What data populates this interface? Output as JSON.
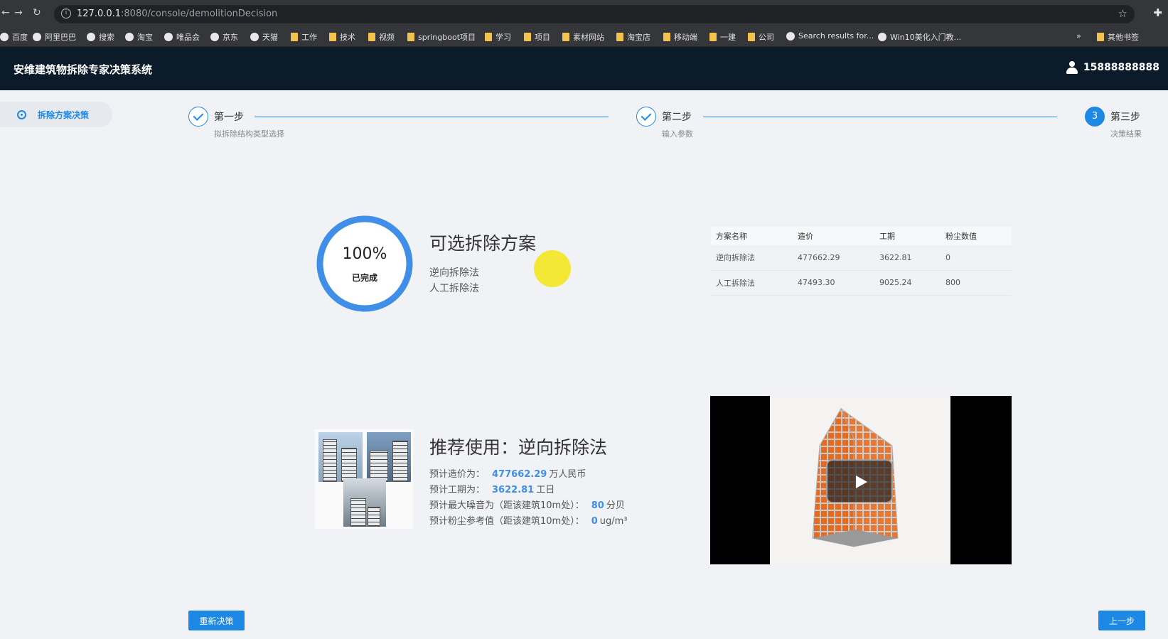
{
  "browser": {
    "url_host": "127.0.0.1",
    "url_rest": ":8080/console/demolitionDecision",
    "bookmarks": [
      {
        "label": "百度",
        "kind": "globe"
      },
      {
        "label": "阿里巴巴",
        "kind": "globe"
      },
      {
        "label": "搜索",
        "kind": "globe"
      },
      {
        "label": "淘宝",
        "kind": "globe"
      },
      {
        "label": "唯品会",
        "kind": "globe"
      },
      {
        "label": "京东",
        "kind": "globe"
      },
      {
        "label": "天猫",
        "kind": "globe"
      },
      {
        "label": "工作",
        "kind": "folder"
      },
      {
        "label": "技术",
        "kind": "folder"
      },
      {
        "label": "视频",
        "kind": "folder"
      },
      {
        "label": "springboot项目",
        "kind": "folder"
      },
      {
        "label": "学习",
        "kind": "folder"
      },
      {
        "label": "项目",
        "kind": "folder"
      },
      {
        "label": "素材网站",
        "kind": "folder"
      },
      {
        "label": "淘宝店",
        "kind": "folder"
      },
      {
        "label": "移动端",
        "kind": "folder"
      },
      {
        "label": "一建",
        "kind": "folder"
      },
      {
        "label": "公司",
        "kind": "folder"
      },
      {
        "label": "Search results for...",
        "kind": "globe"
      },
      {
        "label": "Win10美化入门教...",
        "kind": "globe"
      }
    ],
    "more": "»",
    "other_bookmarks": "其他书签"
  },
  "app": {
    "title": "安维建筑物拆除专家决策系统",
    "username": "15888888888"
  },
  "sidebar": {
    "items": [
      {
        "label": "拆除方案决策"
      }
    ]
  },
  "steps": [
    {
      "title": "第一步",
      "desc": "拟拆除结构类型选择",
      "status": "done"
    },
    {
      "title": "第二步",
      "desc": "输入参数",
      "status": "done"
    },
    {
      "title": "第三步",
      "desc": "决策结果",
      "status": "active",
      "number": "3"
    }
  ],
  "progress": {
    "percent_label": "100%",
    "status": "已完成",
    "fraction": 1.0
  },
  "options": {
    "title": "可选拆除方案",
    "items": [
      "逆向拆除法",
      "人工拆除法"
    ]
  },
  "table": {
    "headers": [
      "方案名称",
      "造价",
      "工期",
      "粉尘数值"
    ],
    "rows": [
      [
        "逆向拆除法",
        "477662.29",
        "3622.81",
        "0"
      ],
      [
        "人工拆除法",
        "47493.30",
        "9025.24",
        "800"
      ]
    ]
  },
  "recommendation": {
    "title": "推荐使用：逆向拆除法",
    "rows": [
      {
        "label": "预计造价为：",
        "value": "477662.29",
        "unit": "万人民币"
      },
      {
        "label": "预计工期为：",
        "value": "3622.81",
        "unit": "工日"
      },
      {
        "label": "预计最大噪音为（距该建筑10m处）：",
        "value": "80",
        "unit": "分贝"
      },
      {
        "label": "预计粉尘参考值（距该建筑10m处）：",
        "value": "0",
        "unit": "ug/m³"
      }
    ]
  },
  "buttons": {
    "redo": "重新决策",
    "prev": "上一步"
  },
  "colors": {
    "primary": "#1e88e5",
    "header_bg": "#0c1b2a",
    "value_blue": "#3f8ee8"
  }
}
